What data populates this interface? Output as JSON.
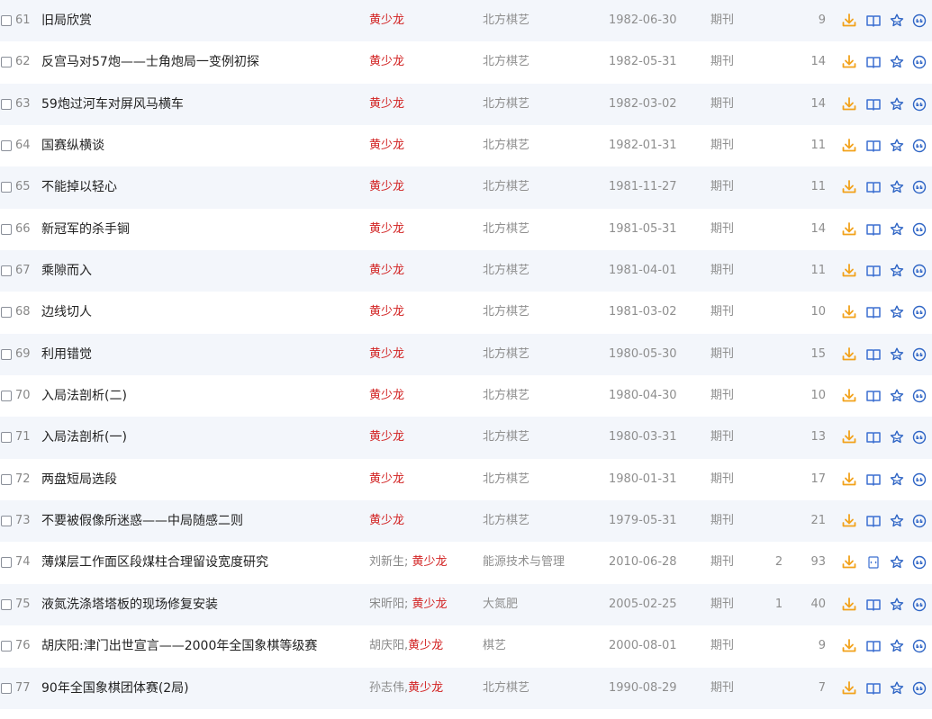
{
  "colors": {
    "highlight_author": "#d22222",
    "download_icon": "#f2a21b",
    "read_icon": "#3b6fd1",
    "action_icon": "#2f65c5",
    "row_alt_bg": "#f3f6fb"
  },
  "icons": [
    "download-icon",
    "read-online-icon",
    "html-read-icon",
    "favorite-icon",
    "cite-icon"
  ],
  "rows": [
    {
      "num": "61",
      "title": "旧局欣赏",
      "authors": [
        {
          "name": "黄少龙",
          "hl": true
        }
      ],
      "source": "北方棋艺",
      "date": "1982-06-30",
      "dbtype": "期刊",
      "cited": "",
      "downloads": "9",
      "read_icon": "read-online-icon"
    },
    {
      "num": "62",
      "title": "反宫马对57炮——士角炮局一变例初探",
      "authors": [
        {
          "name": "黄少龙",
          "hl": true
        }
      ],
      "source": "北方棋艺",
      "date": "1982-05-31",
      "dbtype": "期刊",
      "cited": "",
      "downloads": "14",
      "read_icon": "read-online-icon"
    },
    {
      "num": "63",
      "title": "59炮过河车对屏风马横车",
      "authors": [
        {
          "name": "黄少龙",
          "hl": true
        }
      ],
      "source": "北方棋艺",
      "date": "1982-03-02",
      "dbtype": "期刊",
      "cited": "",
      "downloads": "14",
      "read_icon": "read-online-icon"
    },
    {
      "num": "64",
      "title": "国赛纵横谈",
      "authors": [
        {
          "name": "黄少龙",
          "hl": true
        }
      ],
      "source": "北方棋艺",
      "date": "1982-01-31",
      "dbtype": "期刊",
      "cited": "",
      "downloads": "11",
      "read_icon": "read-online-icon"
    },
    {
      "num": "65",
      "title": "不能掉以轻心",
      "authors": [
        {
          "name": "黄少龙",
          "hl": true
        }
      ],
      "source": "北方棋艺",
      "date": "1981-11-27",
      "dbtype": "期刊",
      "cited": "",
      "downloads": "11",
      "read_icon": "read-online-icon"
    },
    {
      "num": "66",
      "title": "新冠军的杀手锏",
      "authors": [
        {
          "name": "黄少龙",
          "hl": true
        }
      ],
      "source": "北方棋艺",
      "date": "1981-05-31",
      "dbtype": "期刊",
      "cited": "",
      "downloads": "14",
      "read_icon": "read-online-icon"
    },
    {
      "num": "67",
      "title": "乘隙而入",
      "authors": [
        {
          "name": "黄少龙",
          "hl": true
        }
      ],
      "source": "北方棋艺",
      "date": "1981-04-01",
      "dbtype": "期刊",
      "cited": "",
      "downloads": "11",
      "read_icon": "read-online-icon"
    },
    {
      "num": "68",
      "title": "边线切人",
      "authors": [
        {
          "name": "黄少龙",
          "hl": true
        }
      ],
      "source": "北方棋艺",
      "date": "1981-03-02",
      "dbtype": "期刊",
      "cited": "",
      "downloads": "10",
      "read_icon": "read-online-icon"
    },
    {
      "num": "69",
      "title": "利用错觉",
      "authors": [
        {
          "name": "黄少龙",
          "hl": true
        }
      ],
      "source": "北方棋艺",
      "date": "1980-05-30",
      "dbtype": "期刊",
      "cited": "",
      "downloads": "15",
      "read_icon": "read-online-icon"
    },
    {
      "num": "70",
      "title": "入局法剖析(二)",
      "authors": [
        {
          "name": "黄少龙",
          "hl": true
        }
      ],
      "source": "北方棋艺",
      "date": "1980-04-30",
      "dbtype": "期刊",
      "cited": "",
      "downloads": "10",
      "read_icon": "read-online-icon"
    },
    {
      "num": "71",
      "title": "入局法剖析(一)",
      "authors": [
        {
          "name": "黄少龙",
          "hl": true
        }
      ],
      "source": "北方棋艺",
      "date": "1980-03-31",
      "dbtype": "期刊",
      "cited": "",
      "downloads": "13",
      "read_icon": "read-online-icon"
    },
    {
      "num": "72",
      "title": "两盘短局选段",
      "authors": [
        {
          "name": "黄少龙",
          "hl": true
        }
      ],
      "source": "北方棋艺",
      "date": "1980-01-31",
      "dbtype": "期刊",
      "cited": "",
      "downloads": "17",
      "read_icon": "read-online-icon"
    },
    {
      "num": "73",
      "title": "不要被假像所迷惑——中局随感二则",
      "authors": [
        {
          "name": "黄少龙",
          "hl": true
        }
      ],
      "source": "北方棋艺",
      "date": "1979-05-31",
      "dbtype": "期刊",
      "cited": "",
      "downloads": "21",
      "read_icon": "read-online-icon"
    },
    {
      "num": "74",
      "title": "薄煤层工作面区段煤柱合理留设宽度研究",
      "authors": [
        {
          "name": "刘新生",
          "hl": false
        },
        {
          "name": "; ",
          "sep": true
        },
        {
          "name": "黄少龙",
          "hl": true
        }
      ],
      "source": "能源技术与管理",
      "date": "2010-06-28",
      "dbtype": "期刊",
      "cited": "2",
      "downloads": "93",
      "read_icon": "html-read-icon"
    },
    {
      "num": "75",
      "title": "液氮洗涤塔塔板的现场修复安装",
      "authors": [
        {
          "name": "宋昕阳",
          "hl": false
        },
        {
          "name": "; ",
          "sep": true
        },
        {
          "name": "黄少龙",
          "hl": true
        }
      ],
      "source": "大氮肥",
      "date": "2005-02-25",
      "dbtype": "期刊",
      "cited": "1",
      "downloads": "40",
      "read_icon": "read-online-icon"
    },
    {
      "num": "76",
      "title": "胡庆阳:津门出世宣言——2000年全国象棋等级赛",
      "authors": [
        {
          "name": "胡庆阳",
          "hl": false
        },
        {
          "name": ",",
          "sep": true
        },
        {
          "name": "黄少龙",
          "hl": true
        }
      ],
      "source": "棋艺",
      "date": "2000-08-01",
      "dbtype": "期刊",
      "cited": "",
      "downloads": "9",
      "read_icon": "read-online-icon"
    },
    {
      "num": "77",
      "title": "90年全国象棋团体赛(2局)",
      "authors": [
        {
          "name": "孙志伟",
          "hl": false
        },
        {
          "name": ",",
          "sep": true
        },
        {
          "name": "黄少龙",
          "hl": true
        }
      ],
      "source": "北方棋艺",
      "date": "1990-08-29",
      "dbtype": "期刊",
      "cited": "",
      "downloads": "7",
      "read_icon": "read-online-icon"
    }
  ]
}
